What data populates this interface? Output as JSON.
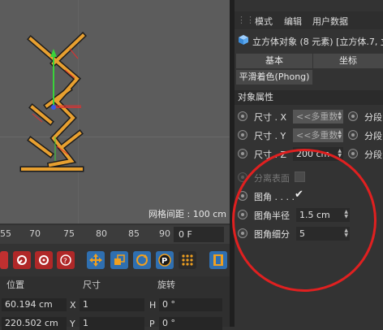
{
  "viewport": {
    "grid_spacing": "网格间距 : 100 cm"
  },
  "timeline": {
    "ticks": [
      "55",
      "70",
      "75",
      "80",
      "85",
      "90"
    ],
    "frame": "0 F"
  },
  "coords": {
    "headers": {
      "position": "位置",
      "size": "尺寸",
      "rotation": "旋转"
    },
    "row1": {
      "pos": "60.194 cm",
      "axis1": "X",
      "size": "1",
      "axis2": "H",
      "rot": "0 °"
    },
    "row2": {
      "pos": "220.502 cm",
      "axis1": "Y",
      "size": "1",
      "axis2": "P",
      "rot": "0 °"
    }
  },
  "attr": {
    "menu": [
      "模式",
      "编辑",
      "用户数据"
    ],
    "object_title": "立方体对象 (8 元素) [立方体.7, 立",
    "tabs": {
      "basic": "基本",
      "coord": "坐标",
      "phong": "平滑着色(Phong)"
    },
    "section": "对象属性",
    "rows": [
      {
        "label": "尺寸 . X",
        "value": "<<多重数",
        "seg": "分段"
      },
      {
        "label": "尺寸 . Y",
        "value": "<<多重数",
        "seg": "分段"
      },
      {
        "label": "尺寸 . Z",
        "value": "200 cm",
        "seg": "分段"
      }
    ],
    "separate": "分离表面",
    "fillet": "图角 . . . .",
    "fillet_check": "✔",
    "fillet_radius_label": "图角半径",
    "fillet_radius": "1.5 cm",
    "fillet_sub_label": "图角细分",
    "fillet_sub": "5"
  },
  "colors": {
    "selection": "#e8a030",
    "annotation": "#e02020",
    "axis_y": "#3ad23a",
    "axis_x": "#e03030",
    "axis_z": "#3a5ae8"
  }
}
